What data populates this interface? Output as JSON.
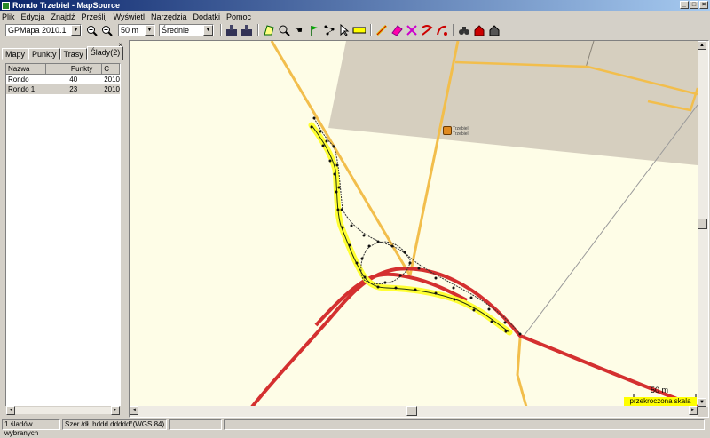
{
  "window": {
    "title": "Rondo Trzebiel - MapSource"
  },
  "menu": [
    "Plik",
    "Edycja",
    "Znajdź",
    "Prześlij",
    "Wyświetl",
    "Narzędzia",
    "Dodatki",
    "Pomoc"
  ],
  "toolbar": {
    "map_product": "GPMapa 2010.1",
    "zoom_scale": "50 m",
    "detail_level": "Średnie"
  },
  "panel": {
    "tabs": [
      "Mapy",
      "Punkty",
      "Trasy",
      "Ślady(2)"
    ],
    "columns": [
      "Nazwa",
      "Punkty",
      "C"
    ],
    "rows": [
      {
        "name": "Rondo",
        "points": "40",
        "date": "2010"
      },
      {
        "name": "Rondo 1",
        "points": "23",
        "date": "2010"
      }
    ]
  },
  "map": {
    "scale_label": "50 m",
    "scale_warning": "przekroczona skala",
    "poi_label": "Trzebiel Trzebiel"
  },
  "status": {
    "selection": "1 śladów wybranych",
    "coord_format": "Szer./dł. hddd.ddddd°(WGS 84)"
  }
}
